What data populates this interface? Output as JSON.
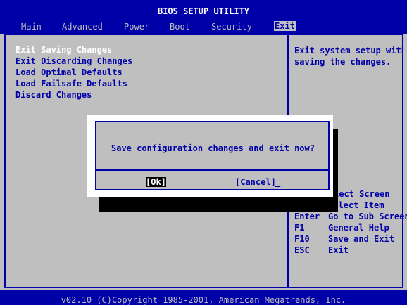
{
  "header": {
    "title": "BIOS SETUP UTILITY",
    "tabs": [
      {
        "label": "Main"
      },
      {
        "label": "Advanced"
      },
      {
        "label": "Power"
      },
      {
        "label": "Boot"
      },
      {
        "label": "Security"
      },
      {
        "label": "Exit"
      }
    ],
    "active_tab": "Exit"
  },
  "menu": {
    "items": [
      {
        "label": "Exit Saving Changes"
      },
      {
        "label": "Exit Discarding Changes"
      },
      {
        "label": "Load Optimal Defaults"
      },
      {
        "label": "Load Failsafe Defaults"
      },
      {
        "label": "Discard Changes"
      }
    ],
    "selected": "Exit Saving Changes"
  },
  "help": {
    "text": "Exit system setup with\nsaving the changes."
  },
  "keys": [
    {
      "key": "",
      "desc": "lect Screen"
    },
    {
      "key": "↑↓",
      "desc": "Select Item"
    },
    {
      "key": "Enter",
      "desc": "Go to Sub Screen"
    },
    {
      "key": "F1",
      "desc": "General Help"
    },
    {
      "key": "F10",
      "desc": "Save and Exit"
    },
    {
      "key": "ESC",
      "desc": "Exit"
    }
  ],
  "dialog": {
    "message": "Save configuration changes and exit now?",
    "ok_label": "[Ok]",
    "cancel_label": "[Cancel]",
    "cursor": "_"
  },
  "footer": {
    "text": "v02.10 (C)Copyright 1985-2001, American Megatrends, Inc."
  },
  "colors": {
    "background": "#bfbfbf",
    "accent": "#0000a8",
    "highlight": "#ffffff"
  }
}
